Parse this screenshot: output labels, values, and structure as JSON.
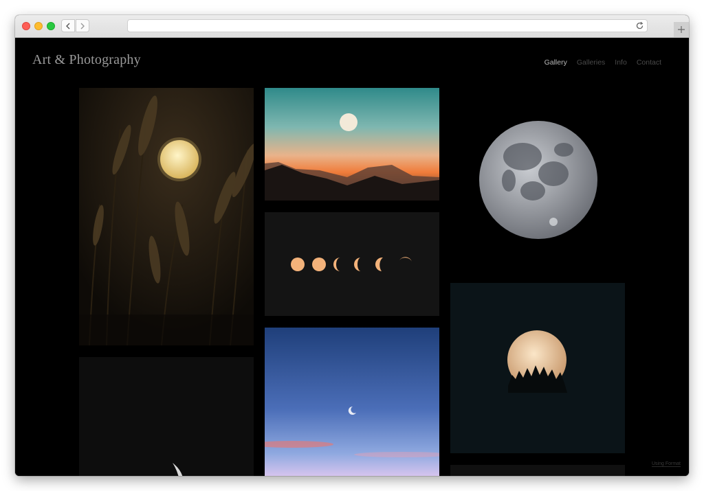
{
  "browser": {
    "back_icon": "chevron-left-icon",
    "forward_icon": "chevron-right-icon",
    "reload_icon": "reload-icon",
    "newtab_icon": "plus-icon"
  },
  "site": {
    "title": "Art & Photography",
    "nav": [
      {
        "label": "Gallery",
        "active": true
      },
      {
        "label": "Galleries",
        "active": false
      },
      {
        "label": "Info",
        "active": false
      },
      {
        "label": "Contact",
        "active": false
      }
    ],
    "footer_link": "Using Format"
  },
  "gallery": {
    "photos": [
      {
        "name": "moon-with-pampas-grass"
      },
      {
        "name": "moon-over-mountains"
      },
      {
        "name": "moon-phases"
      },
      {
        "name": "full-moon-grey"
      },
      {
        "name": "crescent-moon-dusk-sky"
      },
      {
        "name": "full-moon-behind-trees"
      },
      {
        "name": "crescent-moon-dark"
      }
    ]
  },
  "colors": {
    "page_background": "#000000",
    "nav_active": "#b9b9b9",
    "nav_inactive": "#4a4a4a"
  }
}
